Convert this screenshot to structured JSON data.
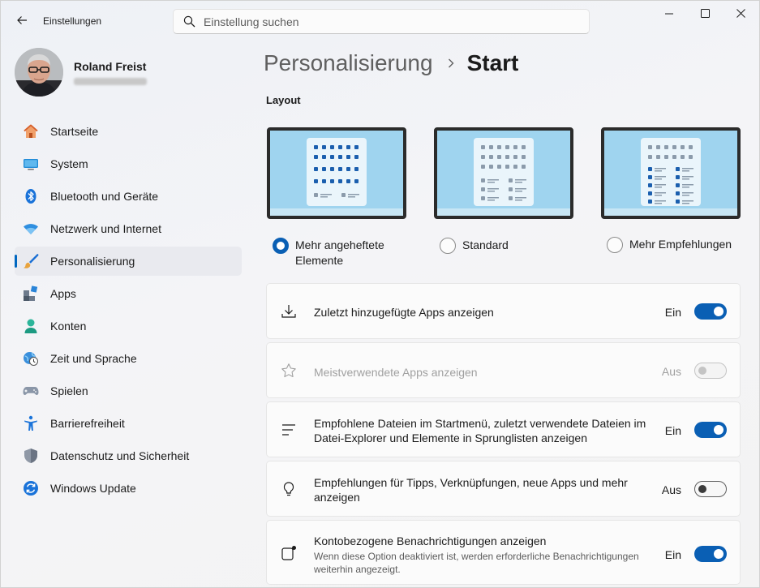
{
  "window": {
    "title": "Einstellungen"
  },
  "search": {
    "placeholder": "Einstellung suchen"
  },
  "profile": {
    "name": "Roland Freist"
  },
  "nav": [
    {
      "label": "Startseite",
      "icon": "home-icon"
    },
    {
      "label": "System",
      "icon": "monitor-icon"
    },
    {
      "label": "Bluetooth und Geräte",
      "icon": "bluetooth-icon"
    },
    {
      "label": "Netzwerk und Internet",
      "icon": "wifi-icon"
    },
    {
      "label": "Personalisierung",
      "icon": "brush-icon",
      "active": true
    },
    {
      "label": "Apps",
      "icon": "apps-icon"
    },
    {
      "label": "Konten",
      "icon": "person-icon"
    },
    {
      "label": "Zeit und Sprache",
      "icon": "globe-clock-icon"
    },
    {
      "label": "Spielen",
      "icon": "gamepad-icon"
    },
    {
      "label": "Barrierefreiheit",
      "icon": "accessibility-icon"
    },
    {
      "label": "Datenschutz und Sicherheit",
      "icon": "shield-icon"
    },
    {
      "label": "Windows Update",
      "icon": "update-icon"
    }
  ],
  "breadcrumb": {
    "parent": "Personalisierung",
    "current": "Start"
  },
  "layout": {
    "title": "Layout",
    "options": [
      {
        "label": "Mehr angeheftete Elemente",
        "selected": true
      },
      {
        "label": "Standard",
        "selected": false
      },
      {
        "label": "Mehr Empfehlungen",
        "selected": false
      }
    ]
  },
  "settings": [
    {
      "icon": "download-icon",
      "label": "Zuletzt hinzugefügte Apps anzeigen",
      "state": "Ein",
      "on": true,
      "disabled": false
    },
    {
      "icon": "star-icon",
      "label": "Meistverwendete Apps anzeigen",
      "state": "Aus",
      "on": false,
      "disabled": true
    },
    {
      "icon": "list-icon",
      "label": "Empfohlene Dateien im Startmenü, zuletzt verwendete Dateien im Datei-Explorer und Elemente in Sprunglisten anzeigen",
      "state": "Ein",
      "on": true,
      "disabled": false
    },
    {
      "icon": "lightbulb-icon",
      "label": "Empfehlungen für Tipps, Verknüpfungen, neue Apps und mehr anzeigen",
      "state": "Aus",
      "on": false,
      "disabled": false
    },
    {
      "icon": "notification-icon",
      "label": "Kontobezogene Benachrichtigungen anzeigen",
      "sublabel": "Wenn diese Option deaktiviert ist, werden erforderliche Benachrichtigungen weiterhin angezeigt.",
      "state": "Ein",
      "on": true,
      "disabled": false
    }
  ],
  "colors": {
    "accent": "#0a5fb4",
    "active_indicator": "#0067c0"
  }
}
